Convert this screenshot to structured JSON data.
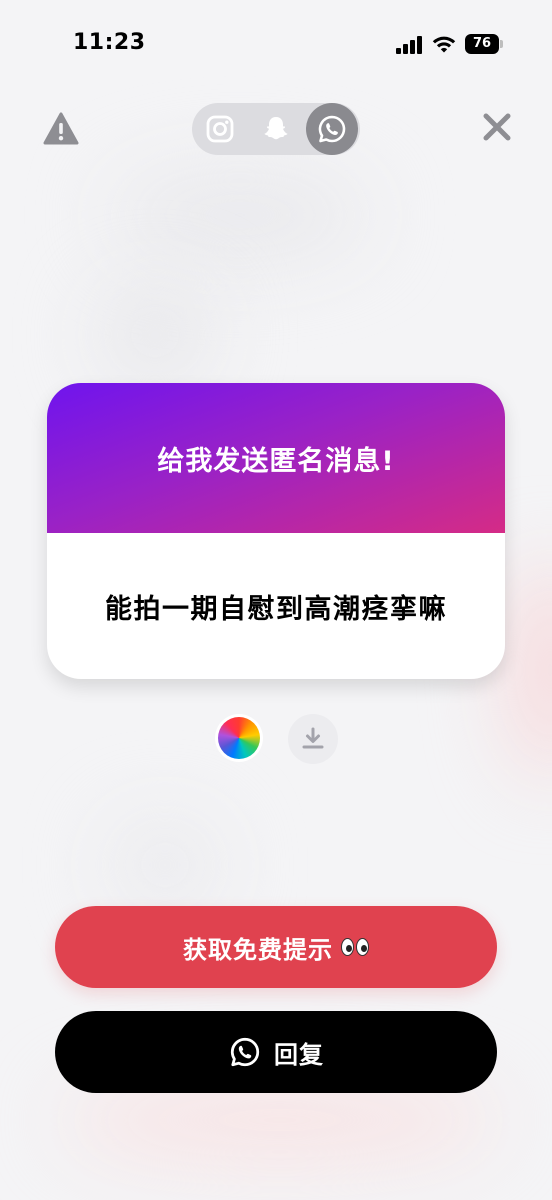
{
  "status_bar": {
    "time": "11:23",
    "battery": "76"
  },
  "top_bar": {
    "platforms": [
      {
        "name": "instagram",
        "icon": "instagram-icon",
        "active": false
      },
      {
        "name": "snapchat",
        "icon": "snapchat-icon",
        "active": false
      },
      {
        "name": "whatsapp",
        "icon": "whatsapp-icon",
        "active": true
      }
    ]
  },
  "card": {
    "title": "给我发送匿名消息!",
    "message": "能拍一期自慰到高潮痉挛嘛"
  },
  "actions": {
    "hint_label": "获取免费提示",
    "reply_label": "回复"
  },
  "colors": {
    "hint_button": "#e0424f",
    "reply_button": "#000000",
    "card_gradient_start": "#6f14ee",
    "card_gradient_end": "#d52b86"
  }
}
